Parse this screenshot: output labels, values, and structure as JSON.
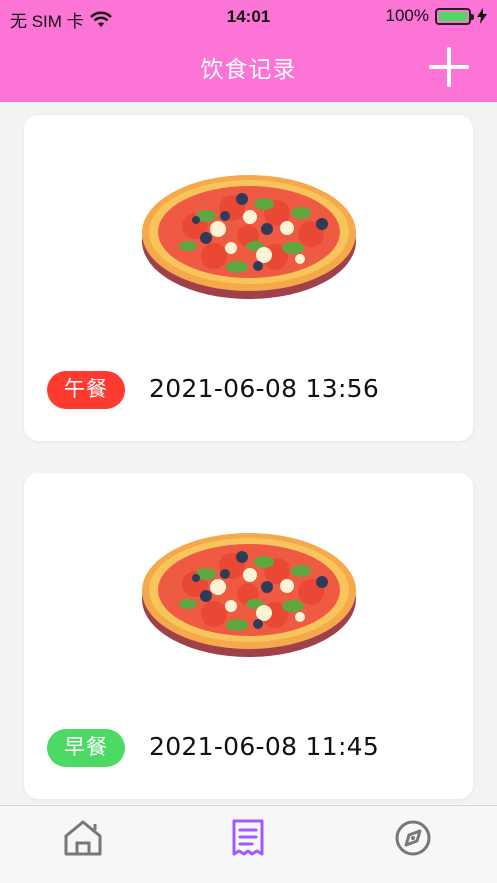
{
  "status_bar": {
    "carrier": "无 SIM 卡",
    "time": "14:01",
    "battery": "100%"
  },
  "header": {
    "title": "饮食记录",
    "background": "#fb74d6",
    "add_icon": "plus-icon"
  },
  "records": [
    {
      "meal": "午餐",
      "badge_color": "#ff3b30",
      "datetime": "2021-06-08 13:56",
      "image": "pizza-image"
    },
    {
      "meal": "早餐",
      "badge_color": "#4cd964",
      "datetime": "2021-06-08 11:45",
      "image": "pizza-image"
    }
  ],
  "tabs": [
    {
      "icon": "home-icon",
      "active": false
    },
    {
      "icon": "receipt-list-icon",
      "active": true,
      "active_color": "#a259ff"
    },
    {
      "icon": "compass-icon",
      "active": false
    }
  ]
}
